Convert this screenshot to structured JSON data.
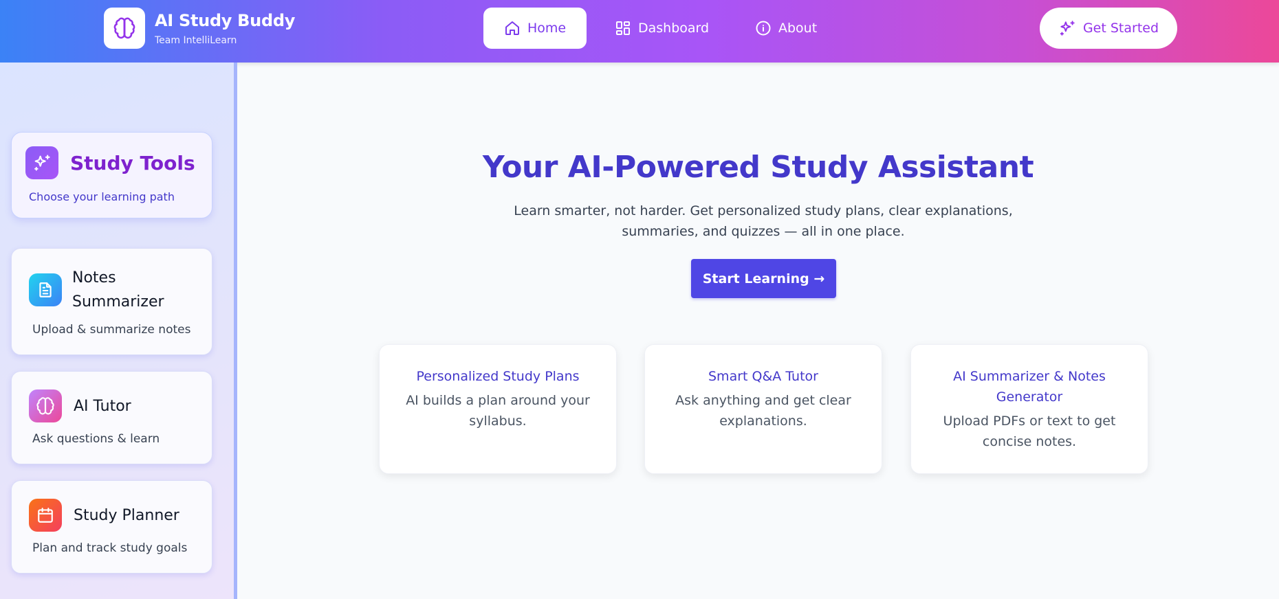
{
  "header": {
    "title": "AI Study Buddy",
    "subtitle": "Team IntelliLearn",
    "nav": [
      {
        "label": "Home",
        "icon": "home-icon",
        "active": true
      },
      {
        "label": "Dashboard",
        "icon": "dashboard-icon",
        "active": false
      },
      {
        "label": "About",
        "icon": "info-icon",
        "active": false
      }
    ],
    "cta_label": "Get Started"
  },
  "sidebar": {
    "heading": "Study Tools",
    "heading_sub": "Choose your learning path",
    "items": [
      {
        "title": "Notes Summarizer",
        "desc": "Upload & summarize notes",
        "icon": "document-icon"
      },
      {
        "title": "AI Tutor",
        "desc": "Ask questions & learn",
        "icon": "brain-icon"
      },
      {
        "title": "Study Planner",
        "desc": "Plan and track study goals",
        "icon": "calendar-icon"
      }
    ]
  },
  "hero": {
    "title": "Your AI-Powered Study Assistant",
    "subtitle": "Learn smarter, not harder. Get personalized study plans, clear explanations, summaries, and quizzes — all in one place.",
    "button": "Start Learning →"
  },
  "features": [
    {
      "title": "Personalized Study Plans",
      "desc": "AI builds a plan around your syllabus."
    },
    {
      "title": "Smart Q&A Tutor",
      "desc": "Ask anything and get clear explanations."
    },
    {
      "title": "AI Summarizer & Notes Generator",
      "desc": "Upload PDFs or text to get concise notes."
    }
  ],
  "colors": {
    "primary": "#4f46e5",
    "accent_purple": "#7c3aed",
    "header_gradient": [
      "#3b82f6",
      "#a855f7",
      "#ec4899"
    ]
  }
}
